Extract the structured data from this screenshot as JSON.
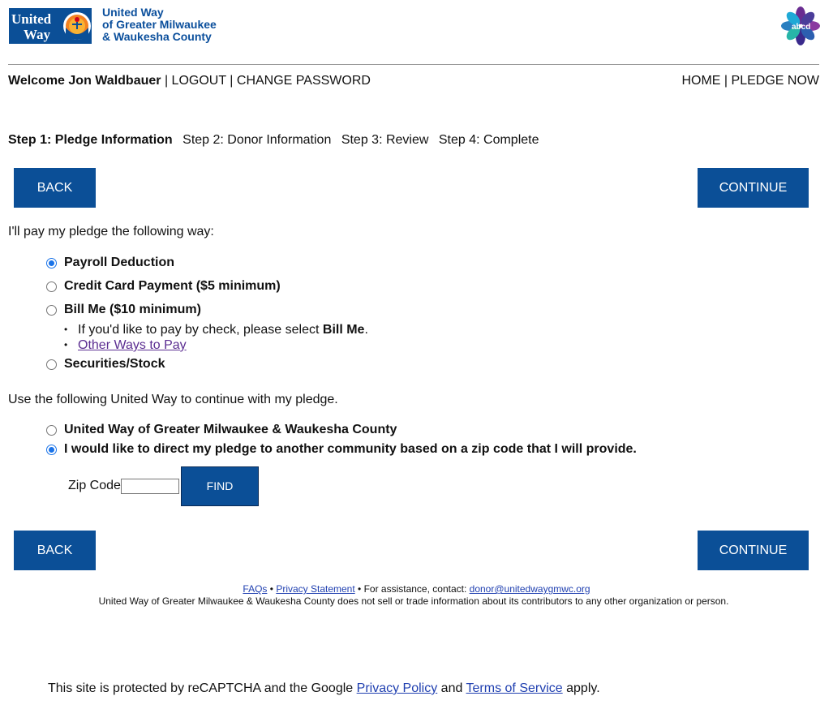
{
  "header": {
    "logo_mark_text_1": "United",
    "logo_mark_text_2": "Way",
    "org_line_1": "United Way",
    "org_line_2": "of Greater Milwaukee",
    "org_line_3": "& Waukesha County",
    "badge_text": "abcd"
  },
  "nav": {
    "welcome": "Welcome Jon Waldbauer",
    "logout": "LOGOUT",
    "change_password": "CHANGE PASSWORD",
    "home": "HOME",
    "pledge_now": "PLEDGE NOW",
    "sep": "|"
  },
  "steps": [
    "Step 1: Pledge Information",
    "Step 2: Donor Information",
    "Step 3: Review",
    "Step 4: Complete"
  ],
  "buttons": {
    "back": "BACK",
    "continue": "CONTINUE",
    "find": "FIND"
  },
  "payment": {
    "prompt": "I'll pay my pledge the following way:",
    "options": [
      {
        "label": "Payroll Deduction",
        "checked": true
      },
      {
        "label": "Credit Card Payment ($5 minimum)",
        "checked": false
      },
      {
        "label": "Bill Me ($10 minimum)",
        "checked": false
      },
      {
        "label": "Securities/Stock",
        "checked": false
      }
    ],
    "bullet_1_prefix": "If you'd like to pay by check, please select ",
    "bullet_1_bold": "Bill Me",
    "bullet_1_suffix": ".",
    "bullet_2_link": "Other Ways to Pay"
  },
  "unitedway": {
    "prompt": "Use the following United Way to continue with my pledge.",
    "options": [
      {
        "label": "United Way of Greater Milwaukee & Waukesha County",
        "checked": false
      },
      {
        "label": "I would like to direct my pledge to another community based on a zip code that I will provide.",
        "checked": true
      }
    ],
    "zip_label": "Zip Code",
    "zip_value": ""
  },
  "footer": {
    "faqs": "FAQs",
    "bullet": "•",
    "privacy": "Privacy Statement",
    "assist": "For assistance, contact:",
    "email": "donor@unitedwaygmwc.org",
    "disclaimer": "United Way of Greater Milwaukee & Waukesha County does not sell or trade information about its contributors to any other organization or person."
  },
  "recaptcha": {
    "prefix": "This site is protected by reCAPTCHA and the Google",
    "privacy": "Privacy Policy",
    "and": "and",
    "terms": "Terms of Service",
    "suffix": "apply."
  },
  "colors": {
    "brand_blue": "#0b4f97",
    "link_blue": "#1f3fb0",
    "visited_purple": "#5b2d91",
    "radio_blue": "#1a73e8"
  }
}
